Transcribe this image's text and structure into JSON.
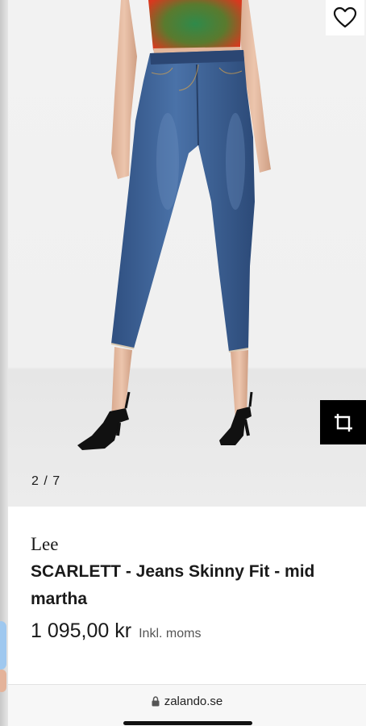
{
  "image": {
    "counter": "2 / 7",
    "favorite_icon": "heart-outline-icon",
    "crop_icon": "crop-icon"
  },
  "product": {
    "brand": "Lee",
    "title": "SCARLETT - Jeans Skinny Fit - mid martha",
    "price": "1 095,00 kr",
    "vat_note": "Inkl. moms"
  },
  "browser": {
    "url": "zalando.se",
    "lock_icon": "lock-icon"
  },
  "colors": {
    "jeans": "#3a5f95",
    "top": "#d9381e",
    "crop_button": "#000000"
  }
}
